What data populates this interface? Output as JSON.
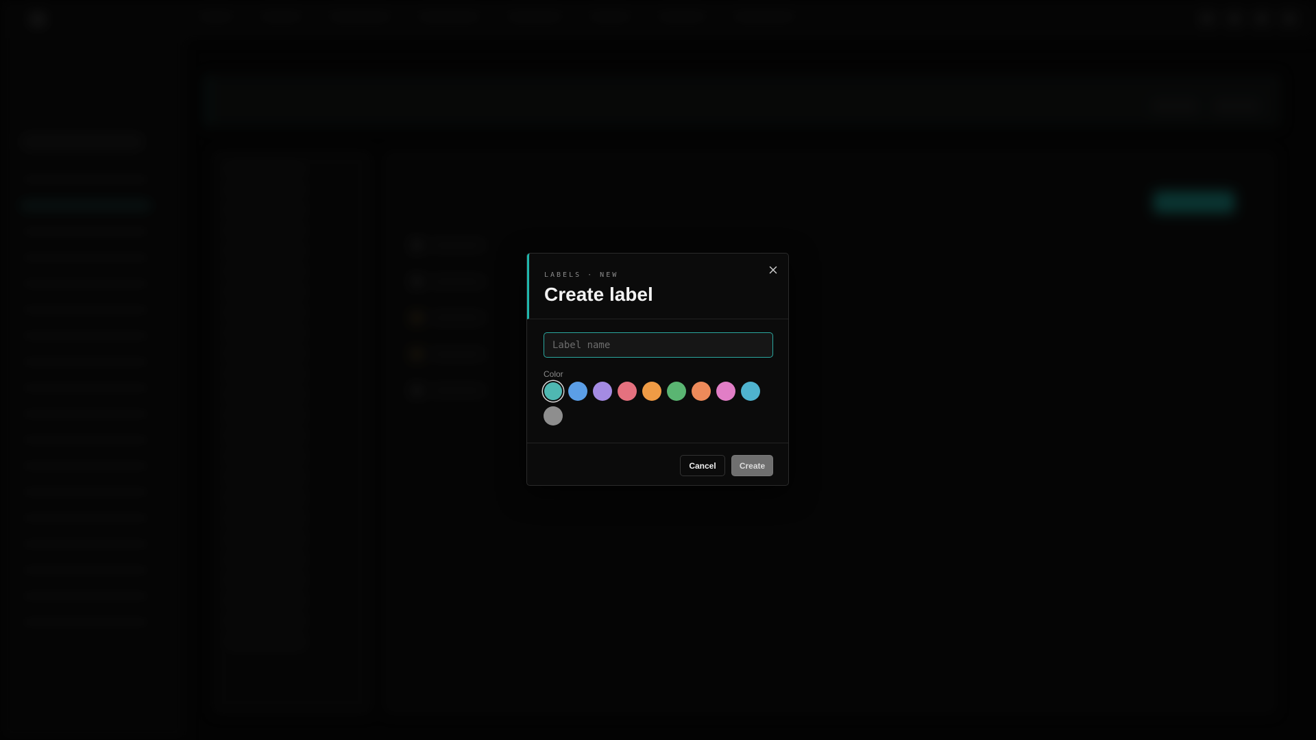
{
  "modal": {
    "eyebrow": "LABELS · NEW",
    "title": "Create label",
    "name_placeholder": "Label name",
    "name_value": "",
    "color_label": "Color",
    "colors": [
      {
        "name": "teal",
        "hex": "#4fb8b2",
        "selected": true
      },
      {
        "name": "blue",
        "hex": "#5b9ee6",
        "selected": false
      },
      {
        "name": "purple",
        "hex": "#a48be3",
        "selected": false
      },
      {
        "name": "red",
        "hex": "#e5717f",
        "selected": false
      },
      {
        "name": "orange",
        "hex": "#ef9b45",
        "selected": false
      },
      {
        "name": "green",
        "hex": "#5ab572",
        "selected": false
      },
      {
        "name": "coral",
        "hex": "#ed8a5a",
        "selected": false
      },
      {
        "name": "pink",
        "hex": "#e17ec6",
        "selected": false
      },
      {
        "name": "cyan",
        "hex": "#4fb3cf",
        "selected": false
      },
      {
        "name": "gray",
        "hex": "#8e8e8e",
        "selected": false
      }
    ],
    "cancel_label": "Cancel",
    "create_label": "Create"
  },
  "background": {
    "accent_color": "#1a8f87"
  }
}
